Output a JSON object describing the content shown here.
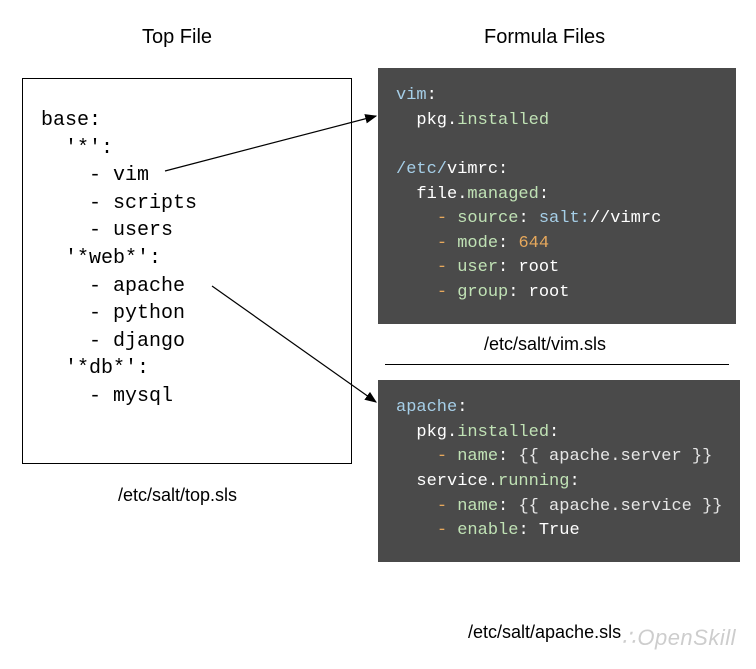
{
  "headings": {
    "left": "Top File",
    "right": "Formula Files"
  },
  "topfile": {
    "caption": "/etc/salt/top.sls",
    "content": {
      "root": "base",
      "targets": [
        {
          "match": "'*'",
          "states": [
            "vim",
            "scripts",
            "users"
          ]
        },
        {
          "match": "'*web*'",
          "states": [
            "apache",
            "python",
            "django"
          ]
        },
        {
          "match": "'*db*'",
          "states": [
            "mysql"
          ]
        }
      ]
    }
  },
  "vim_sls": {
    "path": "/etc/salt/vim.sls",
    "states": {
      "vim": {
        "module": "pkg.installed"
      },
      "/etc/vimrc": {
        "module": "file.managed",
        "args": {
          "source": "salt://vimrc",
          "mode": "644",
          "user": "root",
          "group": "root"
        }
      }
    }
  },
  "apache_sls": {
    "path": "/etc/salt/apache.sls",
    "states": {
      "apache": {
        "pkg.installed": {
          "name": "{{ apache.server }}"
        },
        "service.running": {
          "name": "{{ apache.service }}",
          "enable": "True"
        }
      }
    }
  },
  "watermark": "OpenSkill"
}
